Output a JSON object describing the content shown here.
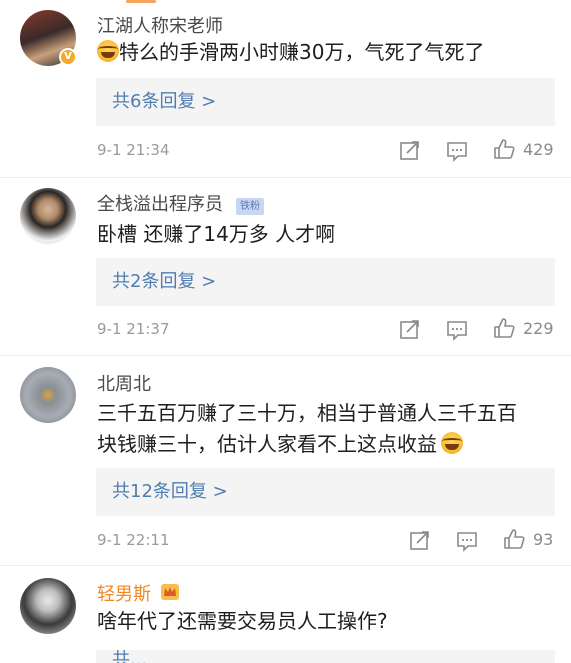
{
  "comments": [
    {
      "name": "江湖人称宋老师",
      "text": "特么的手滑两小时赚30万，气死了气死了",
      "reply": "共6条回复 >",
      "time": "9-1 21:34",
      "likes": "429",
      "emoji_start": "crying-laughing-emoji"
    },
    {
      "name": "全栈溢出程序员",
      "badge": "铁粉",
      "text": "卧槽 还赚了14万多 人才啊",
      "reply": "共2条回复 >",
      "time": "9-1 21:37",
      "likes": "229"
    },
    {
      "name": "北周北",
      "text_line1": "三千五百万赚了三十万，相当于普通人三千五百",
      "text_line2": "块钱赚三十，估计人家看不上这点收益",
      "reply": "共12条回复 >",
      "time": "9-1 22:11",
      "likes": "93",
      "emoji_end": "crying-laughing-emoji"
    },
    {
      "name": "轻男斯",
      "text": "啥年代了还需要交易员人工操作?",
      "reply": "共..."
    }
  ],
  "icons": {
    "share": "share-icon",
    "comment": "comment-icon",
    "like": "thumbs-up-icon",
    "verified": "verified-v-icon",
    "crown": "crown-badge-icon"
  },
  "colors": {
    "link_blue": "#507daf",
    "name_gray": "#4a4a4a",
    "name_orange": "#f08a24",
    "reply_bg": "#f4f4f4"
  },
  "verified_glyph": "V"
}
